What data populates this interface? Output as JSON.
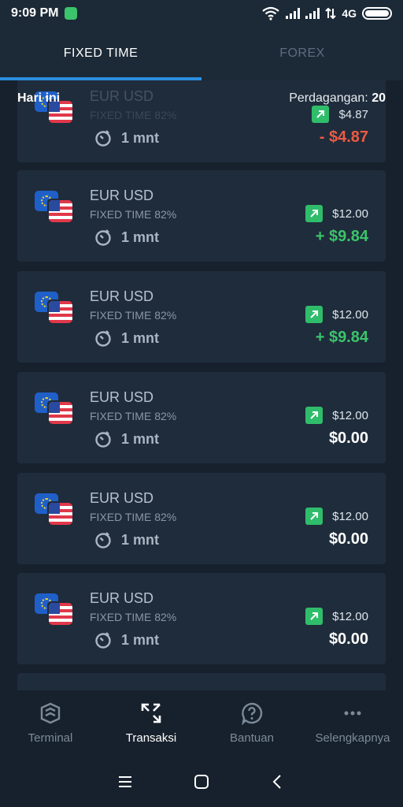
{
  "status_bar": {
    "time": "9:09 PM",
    "network": "4G",
    "icons": [
      "app-notification-icon",
      "wifi-icon",
      "signal-icon",
      "signal-icon",
      "data-arrows-icon",
      "battery-icon"
    ]
  },
  "tabs": [
    {
      "label": "FIXED TIME",
      "active": true
    },
    {
      "label": "FOREX",
      "active": false
    }
  ],
  "summary": {
    "today_label": "Hari ini",
    "trades_label": "Perdagangan: ",
    "trades_count": "20"
  },
  "trades": [
    {
      "pair": "EUR USD",
      "mode": "FIXED TIME 82%",
      "duration": "1 mnt",
      "amount": "$4.87",
      "result": "- $4.87",
      "result_type": "neg"
    },
    {
      "pair": "EUR USD",
      "mode": "FIXED TIME 82%",
      "duration": "1 mnt",
      "amount": "$12.00",
      "result": "+ $9.84",
      "result_type": "pos"
    },
    {
      "pair": "EUR USD",
      "mode": "FIXED TIME 82%",
      "duration": "1 mnt",
      "amount": "$12.00",
      "result": "+ $9.84",
      "result_type": "pos"
    },
    {
      "pair": "EUR USD",
      "mode": "FIXED TIME 82%",
      "duration": "1 mnt",
      "amount": "$12.00",
      "result": "$0.00",
      "result_type": "zero"
    },
    {
      "pair": "EUR USD",
      "mode": "FIXED TIME 82%",
      "duration": "1 mnt",
      "amount": "$12.00",
      "result": "$0.00",
      "result_type": "zero"
    },
    {
      "pair": "EUR USD",
      "mode": "FIXED TIME 82%",
      "duration": "1 mnt",
      "amount": "$12.00",
      "result": "$0.00",
      "result_type": "zero"
    }
  ],
  "bottom_nav": [
    {
      "label": "Terminal",
      "icon": "terminal-icon",
      "active": false
    },
    {
      "label": "Transaksi",
      "icon": "transactions-icon",
      "active": true
    },
    {
      "label": "Bantuan",
      "icon": "help-icon",
      "active": false
    },
    {
      "label": "Selengkapnya",
      "icon": "more-icon",
      "active": false
    }
  ],
  "colors": {
    "background": "#17212d",
    "card": "#1f2c3b",
    "accent": "#2b8fe0",
    "positive": "#3bc46b",
    "negative": "#ef5a42"
  }
}
